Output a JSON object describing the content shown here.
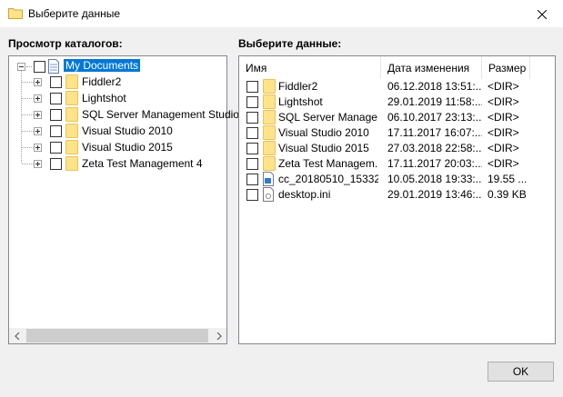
{
  "window": {
    "title": "Выберите данные"
  },
  "left": {
    "label": "Просмотр каталогов:"
  },
  "right": {
    "label": "Выберите данные:"
  },
  "tree": {
    "root": "My Documents",
    "items": [
      "Fiddler2",
      "Lightshot",
      "SQL Server Management Studio",
      "Visual Studio 2010",
      "Visual Studio 2015",
      "Zeta Test Management 4"
    ]
  },
  "list": {
    "columns": [
      "Имя",
      "Дата изменения",
      "Размер"
    ],
    "rows": [
      {
        "name": "Fiddler2",
        "date": "06.12.2018 13:51:...",
        "size": "<DIR>",
        "icon": "folder-icon"
      },
      {
        "name": "Lightshot",
        "date": "29.01.2019 11:58:...",
        "size": "<DIR>",
        "icon": "folder-icon"
      },
      {
        "name": "SQL Server Manage...",
        "date": "06.10.2017 23:13:...",
        "size": "<DIR>",
        "icon": "folder-icon"
      },
      {
        "name": "Visual Studio 2010",
        "date": "17.11.2017 16:07:...",
        "size": "<DIR>",
        "icon": "folder-icon"
      },
      {
        "name": "Visual Studio 2015",
        "date": "27.03.2018 22:58:...",
        "size": "<DIR>",
        "icon": "folder-icon"
      },
      {
        "name": "Zeta Test Managem...",
        "date": "17.11.2017 20:03:...",
        "size": "<DIR>",
        "icon": "folder-icon"
      },
      {
        "name": "cc_20180510_15332...",
        "date": "10.05.2018 19:33:...",
        "size": "19.55 ...",
        "icon": "image-file-icon"
      },
      {
        "name": "desktop.ini",
        "date": "29.01.2019 13:46:...",
        "size": "0.39 KB",
        "icon": "settings-file-icon"
      }
    ]
  },
  "buttons": {
    "ok": "OK"
  },
  "colors": {
    "selection": "#0078d7",
    "folder": "#ffe38a",
    "border": "#828790"
  }
}
